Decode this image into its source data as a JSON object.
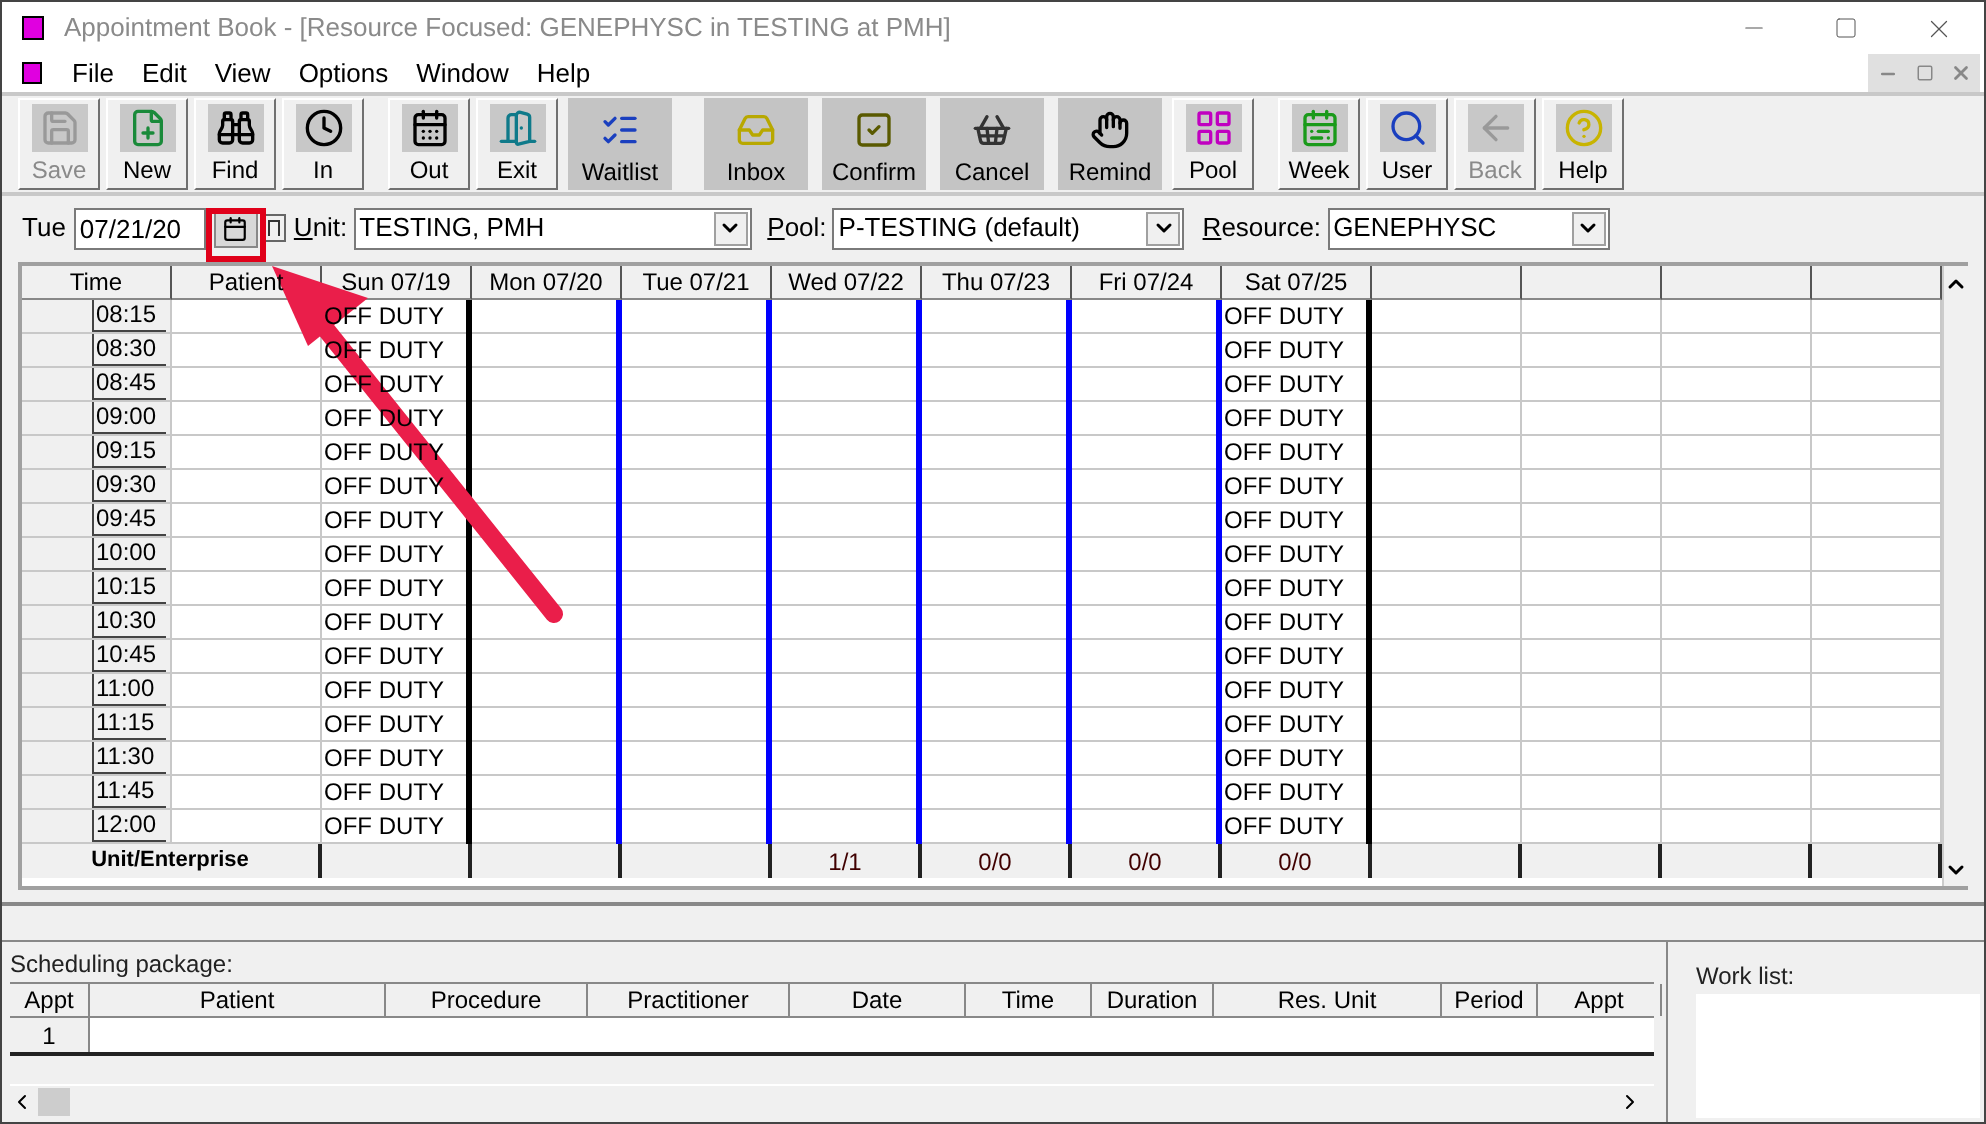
{
  "window": {
    "title": "Appointment Book - [Resource Focused:  GENEPHYSC in TESTING at PMH]"
  },
  "menu": [
    "File",
    "Edit",
    "View",
    "Options",
    "Window",
    "Help"
  ],
  "toolbar": [
    {
      "label": "Save",
      "disabled": true,
      "kind": "raised"
    },
    {
      "label": "New",
      "disabled": false,
      "kind": "raised"
    },
    {
      "label": "Find",
      "disabled": false,
      "kind": "raised"
    },
    {
      "label": "In",
      "disabled": false,
      "kind": "raised"
    },
    {
      "label": "Out",
      "disabled": false,
      "kind": "raised"
    },
    {
      "label": "Exit",
      "disabled": false,
      "kind": "raised"
    },
    {
      "label": "Waitlist",
      "disabled": false,
      "kind": "flat"
    },
    {
      "label": "Inbox",
      "disabled": false,
      "kind": "flat"
    },
    {
      "label": "Confirm",
      "disabled": false,
      "kind": "flat"
    },
    {
      "label": "Cancel",
      "disabled": false,
      "kind": "flat"
    },
    {
      "label": "Remind",
      "disabled": false,
      "kind": "flat"
    },
    {
      "label": "Pool",
      "disabled": false,
      "kind": "raised"
    },
    {
      "label": "Week",
      "disabled": false,
      "kind": "raised"
    },
    {
      "label": "User",
      "disabled": false,
      "kind": "raised"
    },
    {
      "label": "Back",
      "disabled": true,
      "kind": "raised"
    },
    {
      "label": "Help",
      "disabled": false,
      "kind": "raised"
    }
  ],
  "filters": {
    "day": "Tue",
    "date": "07/21/20",
    "unit_label": "Unit:",
    "unit": "TESTING, PMH",
    "pool_label": "Pool:",
    "pool": "P-TESTING (default)",
    "resource_label": "Resource:",
    "resource": "GENEPHYSC"
  },
  "grid": {
    "time_column": {
      "label": "Time",
      "cells": [
        "08:15",
        "08:30",
        "08:45",
        "09:00",
        "09:15",
        "09:30",
        "09:45",
        "10:00",
        "10:15",
        "10:30",
        "10:45",
        "11:00",
        "11:15",
        "11:30",
        "11:45",
        "12:00"
      ]
    },
    "patient_column": {
      "label": "Patient"
    },
    "day_columns": [
      {
        "label": "Sun 07/19",
        "color": "#000000",
        "cells": [
          "OFF DUTY",
          "OFF DUTY",
          "OFF DUTY",
          "OFF DUTY",
          "OFF DUTY",
          "OFF DUTY",
          "OFF DUTY",
          "OFF DUTY",
          "OFF DUTY",
          "OFF DUTY",
          "OFF DUTY",
          "OFF DUTY",
          "OFF DUTY",
          "OFF DUTY",
          "OFF DUTY",
          "OFF DUTY"
        ]
      },
      {
        "label": "Mon 07/20",
        "color": "#0000ff"
      },
      {
        "label": "Tue 07/21",
        "color": "#0000ff"
      },
      {
        "label": "Wed 07/22",
        "color": "#0000ff",
        "total": "1/1"
      },
      {
        "label": "Thu 07/23",
        "color": "#0000ff",
        "total": "0/0"
      },
      {
        "label": "Fri 07/24",
        "color": "#0000ff",
        "total": "0/0"
      },
      {
        "label": "Sat 07/25",
        "color": "#000000",
        "total": "0/0",
        "cells": [
          "OFF DUTY",
          "OFF DUTY",
          "OFF DUTY",
          "OFF DUTY",
          "OFF DUTY",
          "OFF DUTY",
          "OFF DUTY",
          "OFF DUTY",
          "OFF DUTY",
          "OFF DUTY",
          "OFF DUTY",
          "OFF DUTY",
          "OFF DUTY",
          "OFF DUTY",
          "OFF DUTY",
          "OFF DUTY"
        ]
      }
    ],
    "footer_label": "Unit/Enterprise"
  },
  "package": {
    "label": "Scheduling package:",
    "columns": [
      "Appt",
      "Patient",
      "Procedure",
      "Practitioner",
      "Date",
      "Time",
      "Duration",
      "Res. Unit",
      "Period",
      "Appt"
    ],
    "rows": [
      {
        "appt": "1"
      }
    ]
  },
  "work_list": {
    "label": "Work list:"
  }
}
